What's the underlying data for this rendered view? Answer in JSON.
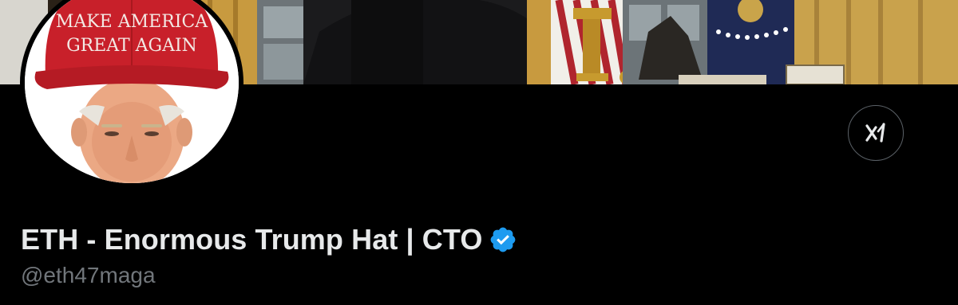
{
  "banner": {
    "image": "oval-office-photo"
  },
  "avatar": {
    "image": "trump-portrait-with-hat",
    "hat_text_line1": "MAKE AMERICA",
    "hat_text_line2": "GREAT AGAIN",
    "hat_color": "#c8202a"
  },
  "header_action": {
    "icon": "grok-icon"
  },
  "profile": {
    "display_name": "ETH - Enormous Trump Hat | CTO",
    "handle": "@eth47maga",
    "verified_icon": "verified-badge-icon",
    "verified_color": "#1d9bf0",
    "name_color": "#e7e9ea",
    "handle_color": "#71767b",
    "background": "#000000"
  }
}
